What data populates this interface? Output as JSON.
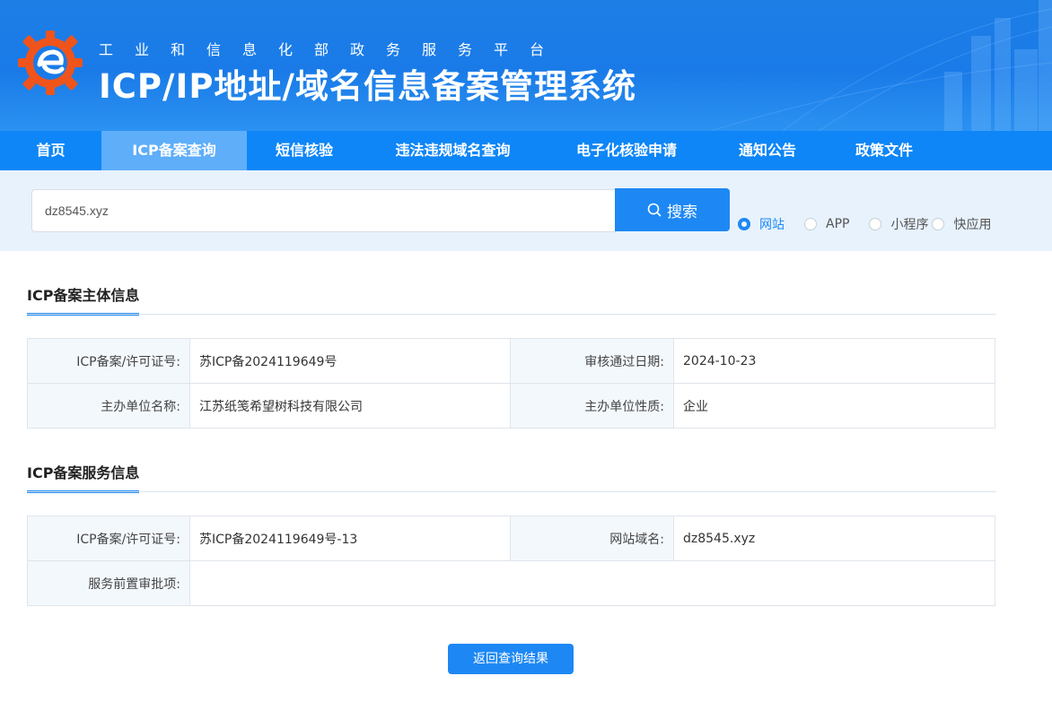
{
  "header": {
    "subtitle": "工业和信息化部政务服务平台",
    "title": "ICP/IP地址/域名信息备案管理系统"
  },
  "nav": {
    "items": [
      {
        "label": "首页"
      },
      {
        "label": "ICP备案查询",
        "active": true
      },
      {
        "label": "短信核验"
      },
      {
        "label": "违法违规域名查询"
      },
      {
        "label": "电子化核验申请"
      },
      {
        "label": "通知公告"
      },
      {
        "label": "政策文件"
      }
    ]
  },
  "search": {
    "value": "dz8545.xyz",
    "button_label": "搜索",
    "types": [
      {
        "label": "网站",
        "checked": true
      },
      {
        "label": "APP"
      },
      {
        "label": "小程序"
      },
      {
        "label": "快应用"
      }
    ]
  },
  "subject": {
    "title": "ICP备案主体信息",
    "license_label": "ICP备案/许可证号:",
    "license_value": "苏ICP备2024119649号",
    "date_label": "审核通过日期:",
    "date_value": "2024-10-23",
    "org_label": "主办单位名称:",
    "org_value": "江苏纸笺希望树科技有限公司",
    "nature_label": "主办单位性质:",
    "nature_value": "企业"
  },
  "service": {
    "title": "ICP备案服务信息",
    "license_label": "ICP备案/许可证号:",
    "license_value": "苏ICP备2024119649号-13",
    "domain_label": "网站域名:",
    "domain_value": "dz8545.xyz",
    "approval_label": "服务前置审批项:",
    "approval_value": ""
  },
  "back_button": "返回查询结果",
  "colors": {
    "primary": "#1d88f4",
    "nav_bg": "#0e86f7",
    "nav_active": "#5eaefa",
    "search_band": "#e7f2fd",
    "logo_orange": "#f0541b"
  }
}
